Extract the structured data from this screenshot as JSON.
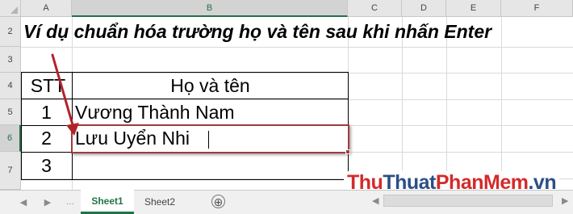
{
  "columns": [
    "A",
    "B",
    "C",
    "D",
    "E",
    "F"
  ],
  "rows": [
    "2",
    "3",
    "4",
    "5",
    "6",
    "7"
  ],
  "title": "Ví dụ chuẩn hóa trường họ và tên sau khi nhấn Enter",
  "table": {
    "header": {
      "stt": "STT",
      "name": "Họ và tên"
    },
    "rows": [
      {
        "stt": "1",
        "name": "Vương Thành Nam"
      },
      {
        "stt": "2",
        "name": "Lưu Uyển Nhi"
      },
      {
        "stt": "3",
        "name": ""
      }
    ]
  },
  "sheets": {
    "active": "Sheet1",
    "other": "Sheet2",
    "add": "⊕"
  },
  "nav": {
    "prev": "◀",
    "next": "▶",
    "more": "…"
  },
  "watermark": {
    "part1": "Thu",
    "part2": "Thuat",
    "part3": "PhanMem",
    "part4": ".vn"
  },
  "colors": {
    "accent": "#217346",
    "selection": "#a23a3f",
    "arrow": "#b2222b"
  }
}
